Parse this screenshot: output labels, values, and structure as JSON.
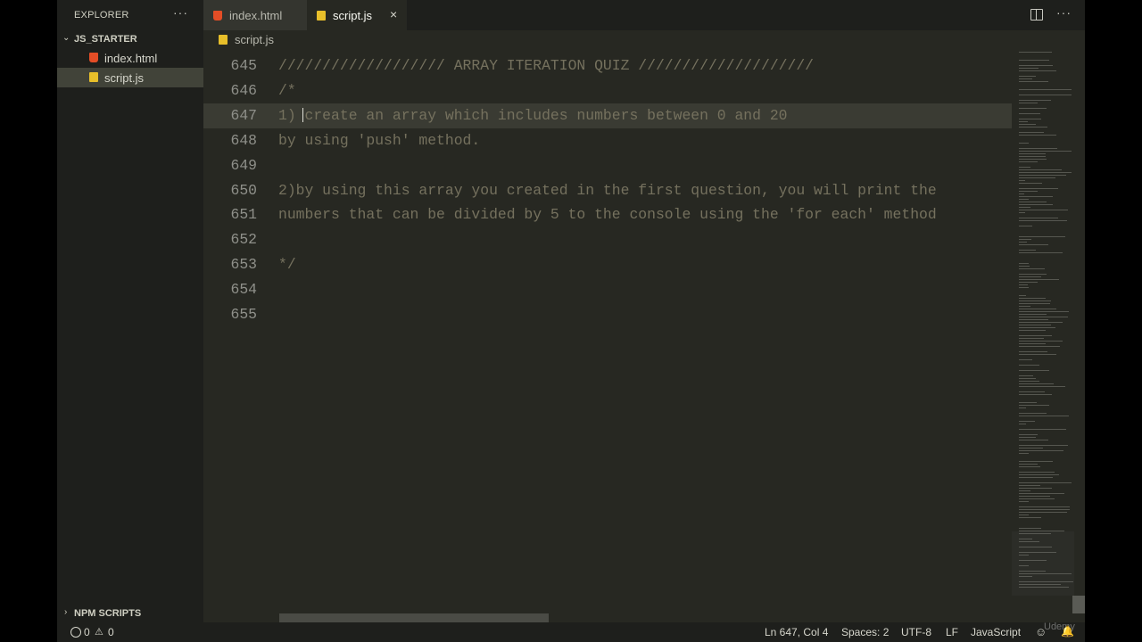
{
  "sidebar": {
    "title": "EXPLORER",
    "more": "···",
    "folder": "JS_STARTER",
    "files": [
      {
        "name": "index.html",
        "icon": "html-file-icon"
      },
      {
        "name": "script.js",
        "icon": "js-file-icon"
      }
    ],
    "npm": "NPM SCRIPTS"
  },
  "tabs": [
    {
      "label": "index.html",
      "icon": "html-file-icon"
    },
    {
      "label": "script.js",
      "icon": "js-file-icon",
      "close": "×"
    }
  ],
  "tab_more": "···",
  "breadcrumb": {
    "file": "script.js"
  },
  "editor": {
    "lines": [
      {
        "num": "645",
        "text": "/////////////////// ARRAY ITERATION QUIZ ////////////////////"
      },
      {
        "num": "646",
        "text": "/*"
      },
      {
        "num": "647",
        "text": "1) create an array which includes numbers between 0 and 20"
      },
      {
        "num": "648",
        "text": "by using 'push' method."
      },
      {
        "num": "649",
        "text": ""
      },
      {
        "num": "650",
        "text": "2)by using this array you created in the first question, you will print the"
      },
      {
        "num": "651",
        "text": "numbers that can be divided by 5 to the console using the 'for each' method"
      },
      {
        "num": "652",
        "text": ""
      },
      {
        "num": "653",
        "text": "*/"
      },
      {
        "num": "654",
        "text": ""
      },
      {
        "num": "655",
        "text": ""
      }
    ]
  },
  "status": {
    "errors": "0",
    "warnings": "0",
    "position": "Ln 647, Col 4",
    "spaces": "Spaces: 2",
    "encoding": "UTF-8",
    "eol": "LF",
    "language": "JavaScript"
  },
  "watermark": "Udemy",
  "colors": {
    "editor_bg": "#272822",
    "sidebar_bg": "#1e1f1c",
    "comment": "#75715e",
    "html_icon": "#e44d26",
    "js_icon": "#e8bf2a"
  }
}
